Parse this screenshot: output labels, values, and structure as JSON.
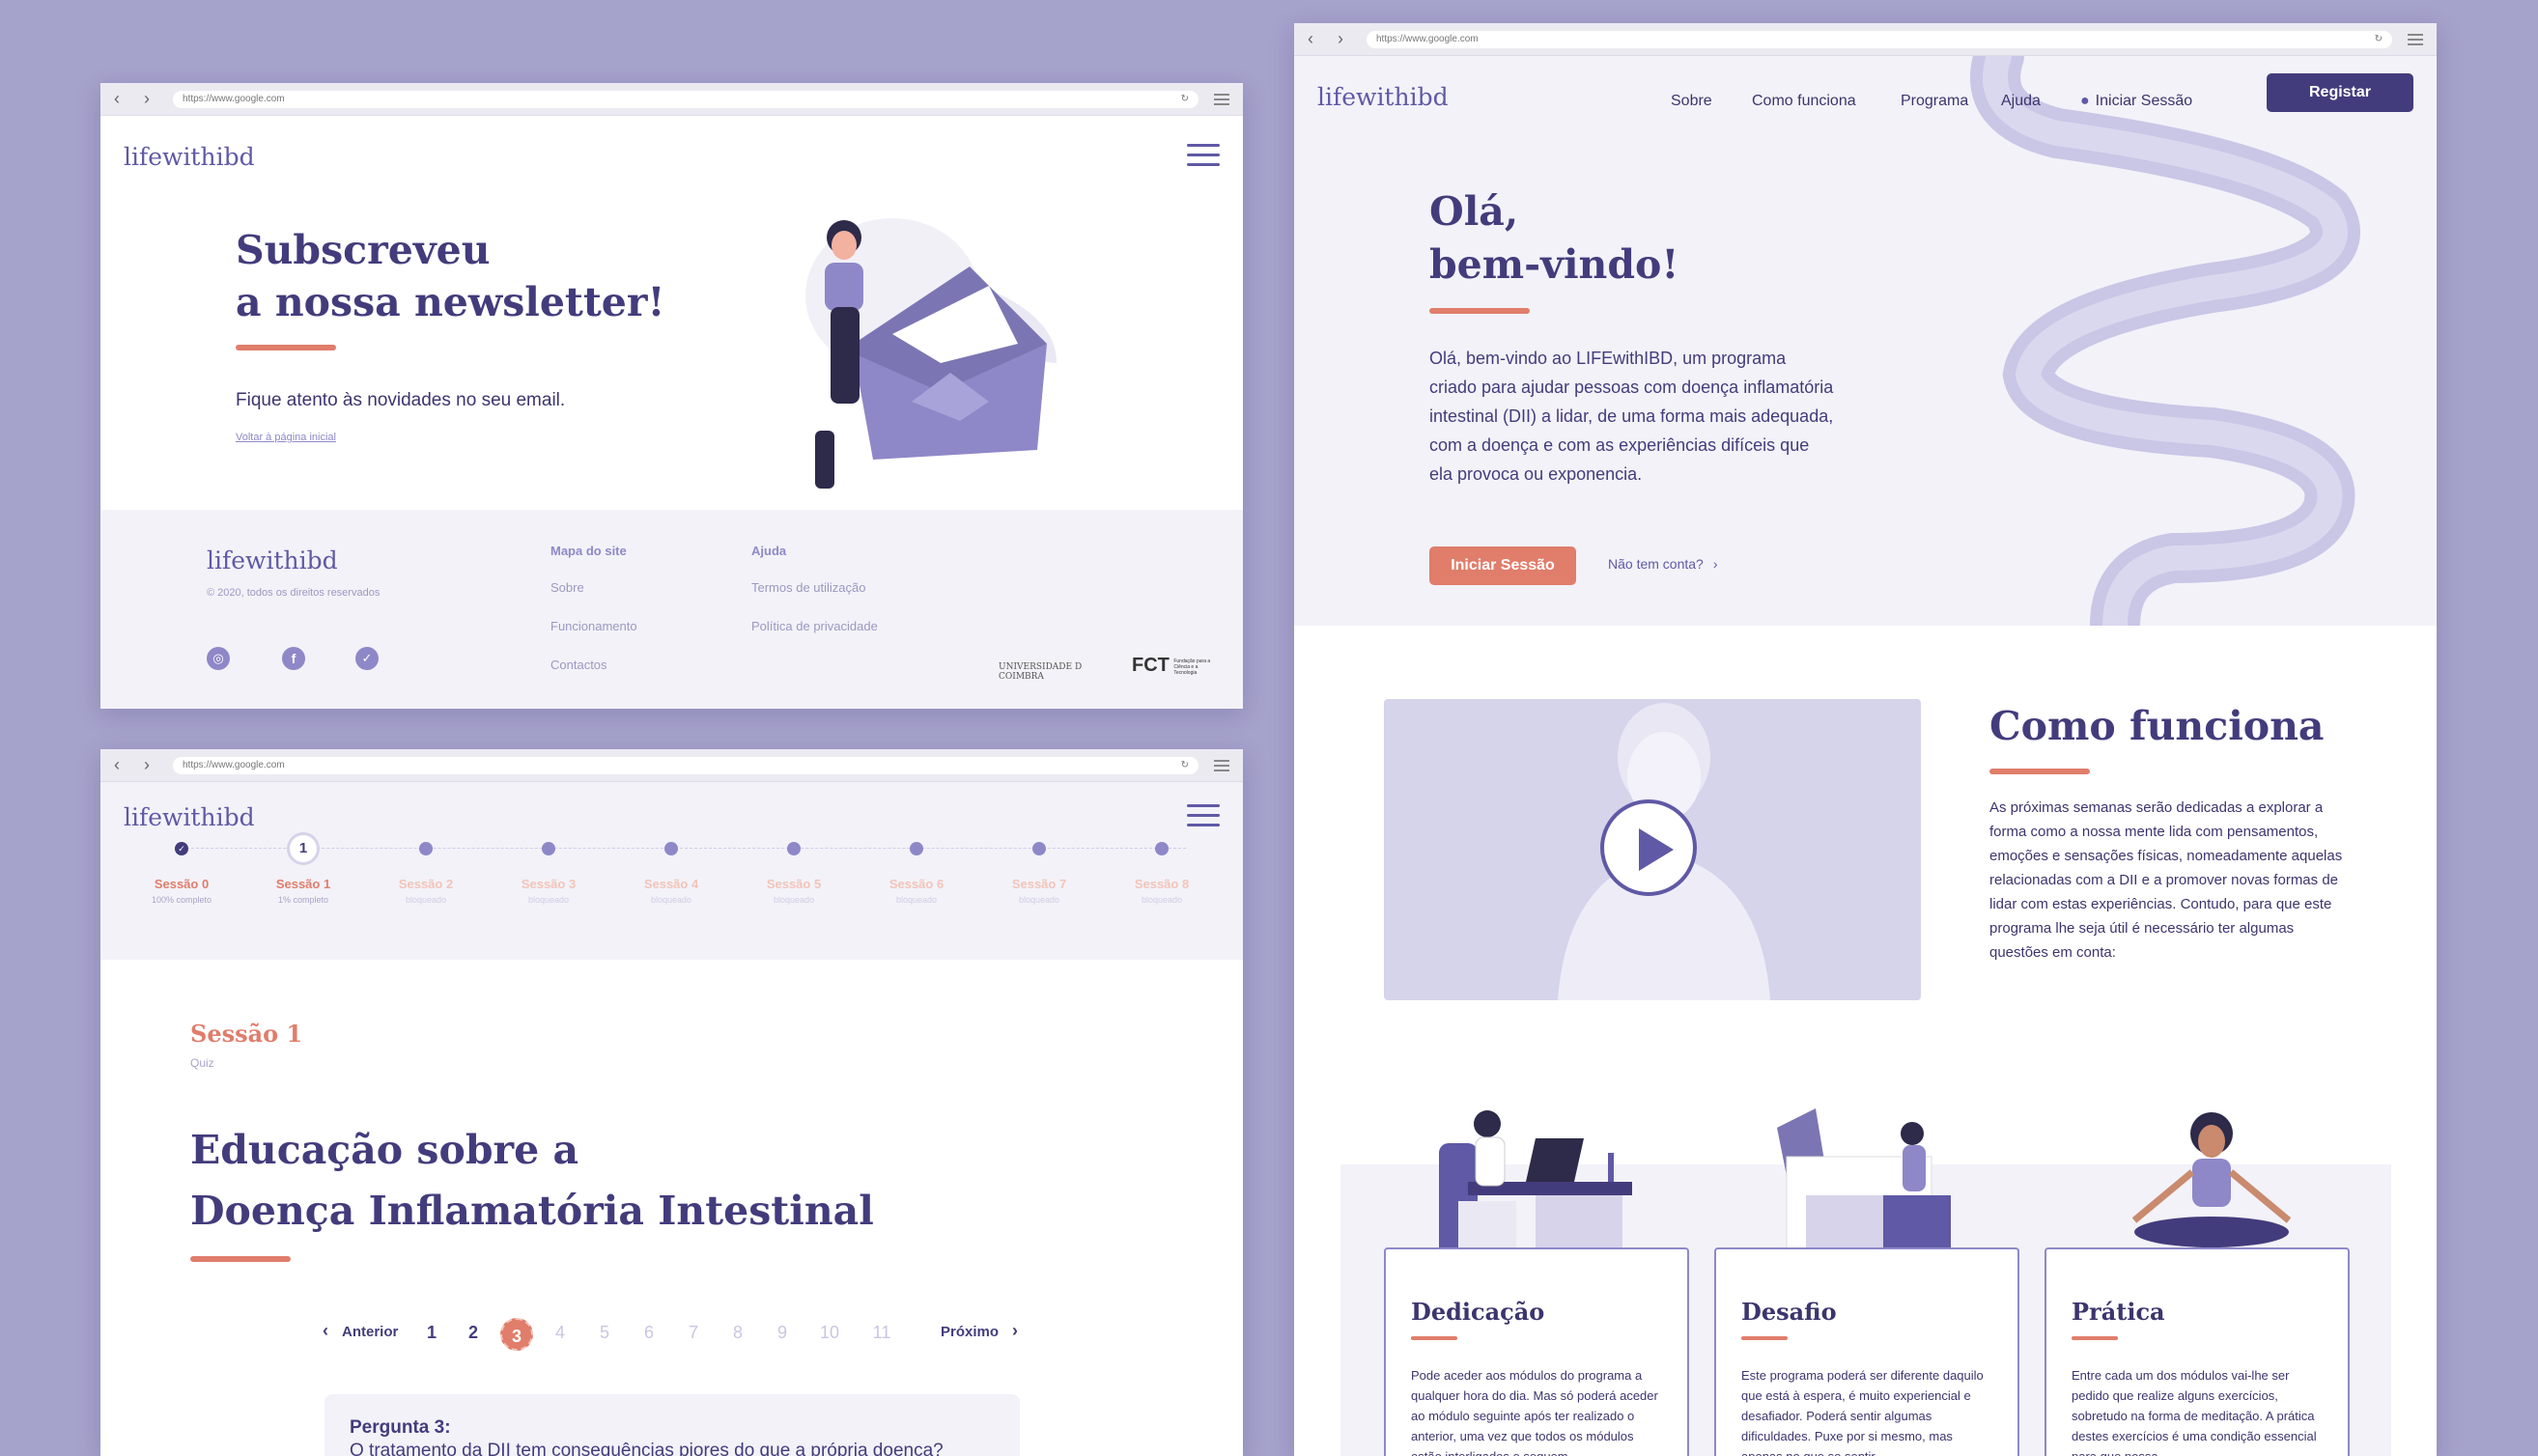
{
  "browser": {
    "url": "https://www.google.com"
  },
  "logo": "lifewithibd",
  "newsletter": {
    "title_line1": "Subscreveu",
    "title_line2": "a nossa newsletter!",
    "subtitle": "Fique atento às novidades no seu email.",
    "back_link": "Voltar à página inicial"
  },
  "footer": {
    "copyright": "© 2020, todos os direitos reservados",
    "sitemap_title": "Mapa do site",
    "sitemap_links": [
      "Sobre",
      "Funcionamento",
      "Contactos"
    ],
    "help_title": "Ajuda",
    "help_links": [
      "Termos de utilização",
      "Política de privacidade"
    ],
    "partner_1": "UNIVERSIDADE D COIMBRA",
    "partner_2": "FCT",
    "partner_2_sub": "Fundação para a Ciência e a Tecnologia"
  },
  "sessions": {
    "steps": [
      {
        "label": "Sessão 0",
        "status": "100% completo"
      },
      {
        "label": "Sessão 1",
        "status": "1% completo",
        "number": "1"
      },
      {
        "label": "Sessão 2",
        "status": "bloqueado"
      },
      {
        "label": "Sessão 3",
        "status": "bloqueado"
      },
      {
        "label": "Sessão 4",
        "status": "bloqueado"
      },
      {
        "label": "Sessão 5",
        "status": "bloqueado"
      },
      {
        "label": "Sessão 6",
        "status": "bloqueado"
      },
      {
        "label": "Sessão 7",
        "status": "bloqueado"
      },
      {
        "label": "Sessão 8",
        "status": "bloqueado"
      }
    ],
    "current_title": "Sessão 1",
    "current_type": "Quiz",
    "heading_line1": "Educação sobre a",
    "heading_line2": "Doença Inflamatória Intestinal",
    "pagination": {
      "prev": "Anterior",
      "next": "Próximo",
      "pages": [
        "1",
        "2",
        "3",
        "4",
        "5",
        "6",
        "7",
        "8",
        "9",
        "10",
        "11"
      ],
      "current": "3"
    },
    "question_label": "Pergunta 3:",
    "question_text": "O tratamento da DII tem consequências piores do que a própria doença?"
  },
  "home": {
    "nav": [
      "Sobre",
      "Como funciona",
      "Programa",
      "Ajuda"
    ],
    "login": "Iniciar Sessão",
    "register": "Registar",
    "hero_title_line1": "Olá,",
    "hero_title_line2": "bem-vindo!",
    "hero_text": "Olá, bem-vindo ao LIFEwithIBD, um programa criado para ajudar pessoas com doença inflamatória intestinal (DII) a lidar, de uma forma mais adequada, com a doença e com as experiências difíceis que ela provoca ou exponencia.",
    "hero_cta": "Iniciar Sessão",
    "no_account": "Não tem conta?",
    "how_title": "Como funciona",
    "how_text": "As próximas semanas serão dedicadas a explorar a forma como a nossa mente lida com pensamentos, emoções e sensações físicas, nomeadamente aquelas relacionadas com a DII e a promover novas formas de lidar com estas experiências. Contudo, para que este programa lhe seja útil é necessário ter algumas questões em conta:",
    "cards": [
      {
        "title": "Dedicação",
        "text": "Pode aceder aos módulos do programa a qualquer hora do dia. Mas só poderá aceder ao módulo seguinte após ter realizado o anterior, uma vez que todos os módulos estão interligados e seguem"
      },
      {
        "title": "Desafio",
        "text": "Este programa poderá ser diferente daquilo que está à espera, é muito experiencial e desafiador. Poderá sentir algumas dificuldades. Puxe por si mesmo, mas apenas no que se sentir"
      },
      {
        "title": "Prática",
        "text": "Entre cada um dos módulos vai-lhe ser pedido que realize alguns exercícios, sobretudo na forma de meditação. A prática destes exercícios é uma condição essencial para que possa"
      }
    ]
  },
  "colors": {
    "background": "#a5a2cc",
    "navy": "#433c7c",
    "accent": "#e07d6b",
    "lavender": "#8e88c8"
  }
}
